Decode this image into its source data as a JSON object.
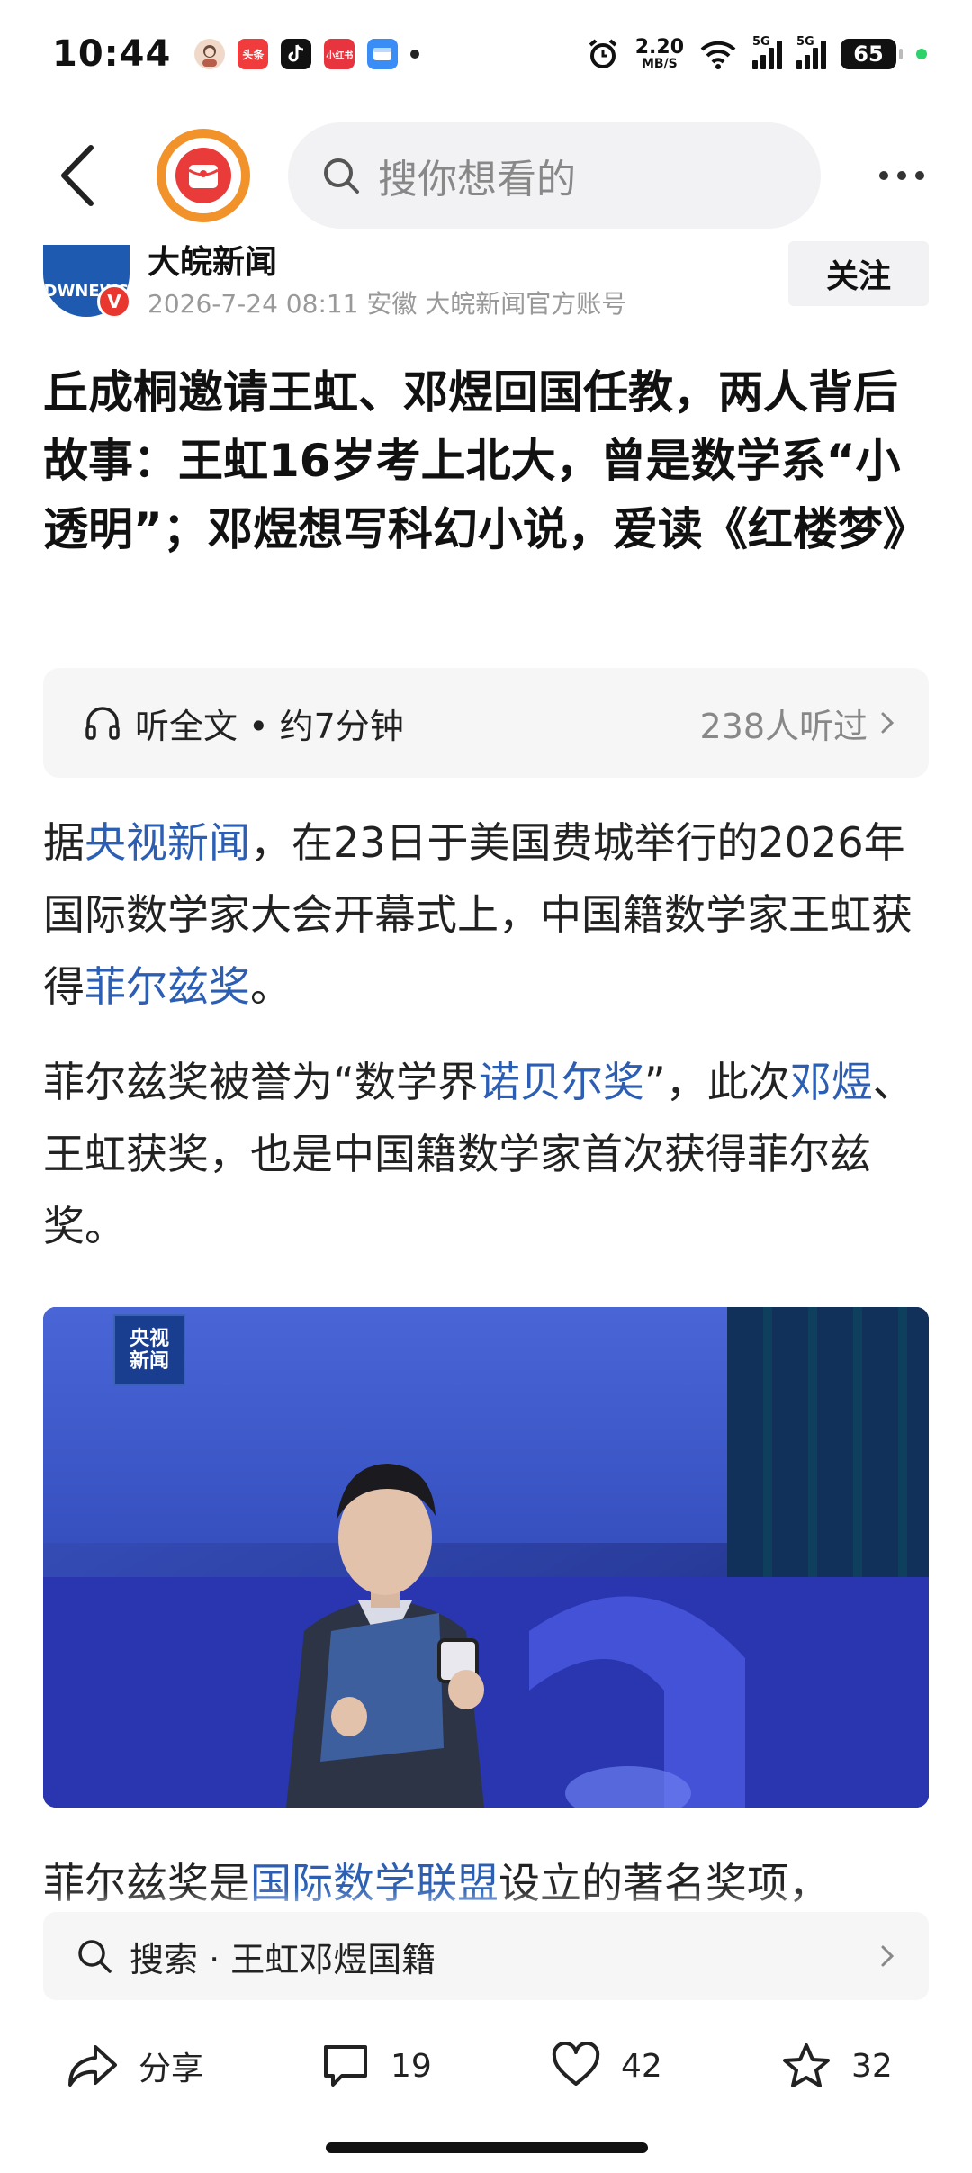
{
  "status_bar": {
    "time": "10:44",
    "app_icons": [
      {
        "name": "avatar-app-icon",
        "label": "",
        "color": "#f0d9c8"
      },
      {
        "name": "toutiao-app-icon",
        "label": "头条",
        "color": "#f03c3c"
      },
      {
        "name": "douyin-app-icon",
        "label": "",
        "color": "#111111"
      },
      {
        "name": "xiaohongshu-app-icon",
        "label": "小红书",
        "color": "#e8343f"
      },
      {
        "name": "message-app-icon",
        "label": "",
        "color": "#3a8df5"
      }
    ],
    "net_speed": "2.20",
    "net_unit": "MB/S",
    "signal1_label": "5G",
    "signal2_label": "5G",
    "battery": "65"
  },
  "topnav": {
    "search_placeholder": "搜你想看的"
  },
  "author": {
    "avatar_text": "DWNEWS",
    "badge": "V",
    "name": "大皖新闻",
    "meta": "2026-7-24  08:11  安徽  大皖新闻官方账号",
    "follow_label": "关注"
  },
  "article": {
    "title": "丘成桐邀请王虹、邓煜回国任教，两人背后故事：王虹16岁考上北大，曾是数学系“小透明”；邓煜想写科幻小说，爱读《红楼梦》",
    "listen_label": "听全文 • 约7分钟",
    "listen_count": "238人听过",
    "p1": {
      "t1": "据",
      "l1": "央视新闻",
      "t2": "，在23日于美国费城举行的2026年国际数学家大会开幕式上，中国籍数学家王虹获得",
      "l2": "菲尔兹奖",
      "t3": "。"
    },
    "p2": {
      "t1": "菲尔兹奖被誉为“数学界",
      "l1": "诺贝尔奖",
      "t2": "”，此次",
      "l2": "邓煜",
      "t3": "、王虹获奖，也是中国籍数学家首次获得菲尔兹奖。"
    },
    "photo_logo_line1": "央视",
    "photo_logo_line2": "新闻",
    "p3": {
      "t1": "菲尔兹奖是",
      "l1": "国际数学联盟",
      "t2": "设立的著名奖项，"
    }
  },
  "suggest": {
    "text": "搜索 · 王虹邓煜国籍"
  },
  "actions": {
    "share_label": "分享",
    "comment_count": "19",
    "like_count": "42",
    "fav_count": "32"
  },
  "colors": {
    "link": "#2c5fb3",
    "accent_orange": "#f1922b",
    "accent_red": "#ea3b3b"
  }
}
